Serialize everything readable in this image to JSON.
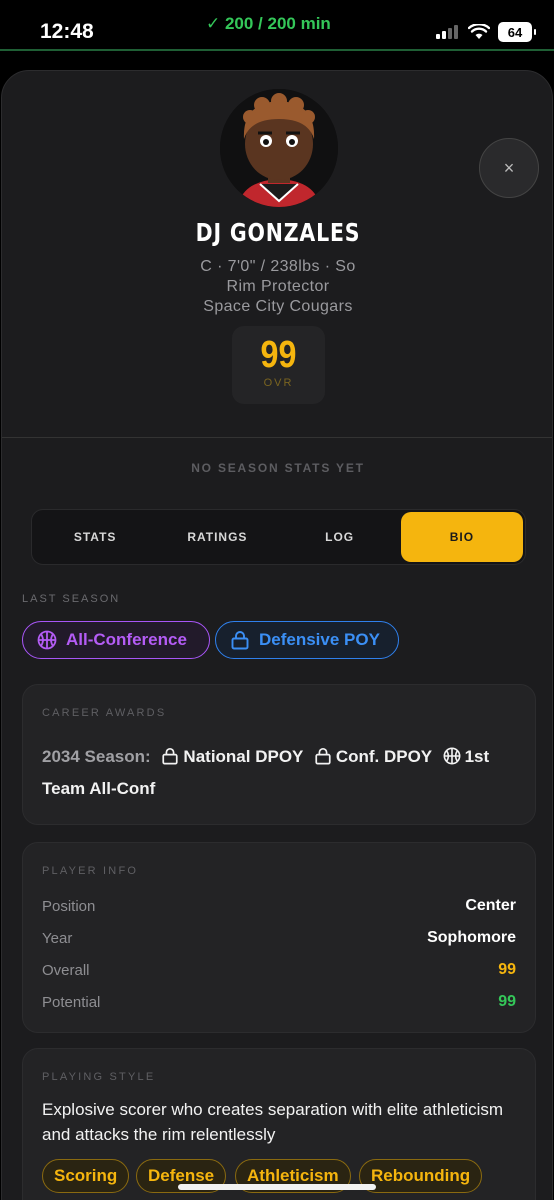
{
  "status_bar": {
    "time": "12:48",
    "screen_time": "✓ 200 / 200 min",
    "battery": "64"
  },
  "player": {
    "name": "DJ GONZALES",
    "line1": "C · 7'0\" / 238lbs · So",
    "archetype": "Rim Protector",
    "team": "Space City Cougars",
    "ovr_value": "99",
    "ovr_label": "OVR"
  },
  "close_label": "×",
  "no_stats": "NO SEASON STATS YET",
  "tabs": [
    {
      "label": "STATS",
      "active": false
    },
    {
      "label": "RATINGS",
      "active": false
    },
    {
      "label": "LOG",
      "active": false
    },
    {
      "label": "BIO",
      "active": true
    }
  ],
  "last_season": {
    "label": "LAST SEASON",
    "badges": [
      {
        "label": "All-Conference",
        "icon": "basketball-icon",
        "color": "#a855f7"
      },
      {
        "label": "Defensive POY",
        "icon": "lock-icon",
        "color": "#2f80ed"
      }
    ]
  },
  "career_awards": {
    "title": "CAREER AWARDS",
    "season": "2034 Season:",
    "award1": "National DPOY",
    "award2": "Conf. DPOY",
    "award3": "1st Team All-Conf"
  },
  "player_info": {
    "title": "PLAYER INFO",
    "rows": [
      {
        "key": "Position",
        "value": "Center"
      },
      {
        "key": "Year",
        "value": "Sophomore"
      },
      {
        "key": "Overall",
        "value": "99"
      },
      {
        "key": "Potential",
        "value": "99"
      }
    ]
  },
  "playing_style": {
    "title": "PLAYING STYLE",
    "description": "Explosive scorer who creates separation with elite athleticism and attacks the rim relentlessly",
    "tags": [
      "Scoring",
      "Defense",
      "Athleticism",
      "Rebounding"
    ]
  },
  "colors": {
    "accent": "#f5b50e",
    "green": "#34c759",
    "purple": "#a855f7",
    "blue": "#2f80ed"
  }
}
